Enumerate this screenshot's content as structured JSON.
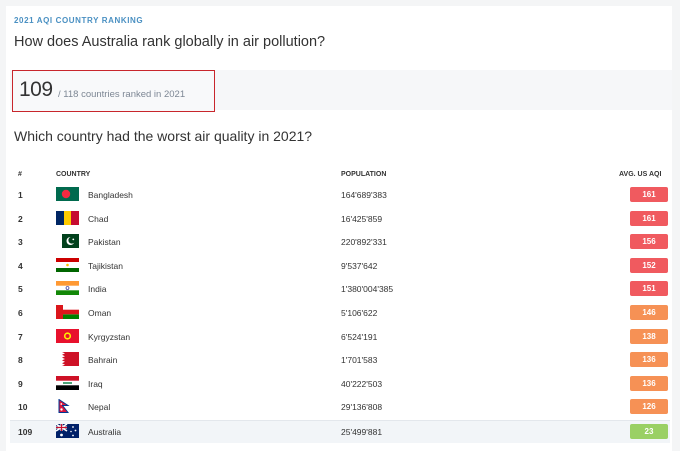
{
  "eyebrow": "2021 AQI COUNTRY RANKING",
  "question1": "How does Australia rank globally in air pollution?",
  "rank": {
    "value": "109",
    "subtitle": "/ 118 countries ranked in 2021"
  },
  "question2": "Which country had the worst air quality in 2021?",
  "table": {
    "headers": {
      "rank": "#",
      "country": "COUNTRY",
      "population": "POPULATION",
      "aqi": "AVG. US AQI"
    },
    "rows": [
      {
        "rank": "1",
        "country": "Bangladesh",
        "population": "164'689'383",
        "aqi": "161",
        "color": "#f05a5f",
        "flag": "bangladesh-flag-icon"
      },
      {
        "rank": "2",
        "country": "Chad",
        "population": "16'425'859",
        "aqi": "161",
        "color": "#f05a5f",
        "flag": "chad-flag-icon"
      },
      {
        "rank": "3",
        "country": "Pakistan",
        "population": "220'892'331",
        "aqi": "156",
        "color": "#f05a5f",
        "flag": "pakistan-flag-icon"
      },
      {
        "rank": "4",
        "country": "Tajikistan",
        "population": "9'537'642",
        "aqi": "152",
        "color": "#f05a5f",
        "flag": "tajikistan-flag-icon"
      },
      {
        "rank": "5",
        "country": "India",
        "population": "1'380'004'385",
        "aqi": "151",
        "color": "#f05a5f",
        "flag": "india-flag-icon"
      },
      {
        "rank": "6",
        "country": "Oman",
        "population": "5'106'622",
        "aqi": "146",
        "color": "#f69155",
        "flag": "oman-flag-icon"
      },
      {
        "rank": "7",
        "country": "Kyrgyzstan",
        "population": "6'524'191",
        "aqi": "138",
        "color": "#f69155",
        "flag": "kyrgyzstan-flag-icon"
      },
      {
        "rank": "8",
        "country": "Bahrain",
        "population": "1'701'583",
        "aqi": "136",
        "color": "#f69155",
        "flag": "bahrain-flag-icon"
      },
      {
        "rank": "9",
        "country": "Iraq",
        "population": "40'222'503",
        "aqi": "136",
        "color": "#f69155",
        "flag": "iraq-flag-icon"
      },
      {
        "rank": "10",
        "country": "Nepal",
        "population": "29'136'808",
        "aqi": "126",
        "color": "#f69155",
        "flag": "nepal-flag-icon"
      },
      {
        "rank": "109",
        "country": "Australia",
        "population": "25'499'881",
        "aqi": "23",
        "color": "#9ad064",
        "flag": "australia-flag-icon",
        "highlight": true
      }
    ]
  }
}
